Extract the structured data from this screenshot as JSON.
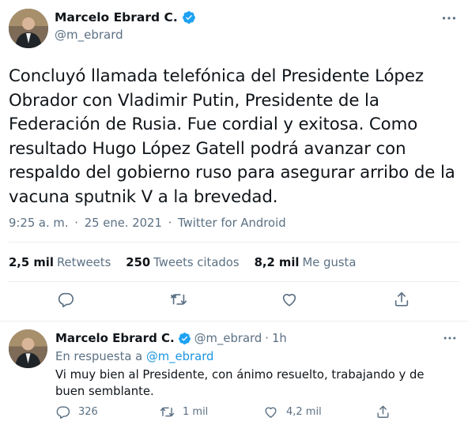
{
  "main_tweet": {
    "display_name": "Marcelo Ebrard C.",
    "handle": "@m_ebrard",
    "text_lines": [
      "Concluyó llamada telefónica del Presidente López",
      "Obrador con Vladimir Putin, Presidente de la",
      "Federación de Rusia. Fue cordial y exitosa. Como",
      "resultado Hugo López Gatell podrá avanzar con",
      "respaldo del gobierno ruso para asegurar arribo de la",
      "vacuna sputnik V a la brevedad."
    ],
    "time": "9:25 a. m.",
    "separator": "·",
    "date": "25 ene. 2021",
    "source": "Twitter for Android",
    "stats": {
      "retweets_count": "2,5 mil",
      "retweets_label": "Retweets",
      "quotes_count": "250",
      "quotes_label": "Tweets citados",
      "likes_count": "8,2 mil",
      "likes_label": "Me gusta"
    },
    "actions": [
      "reply-icon",
      "retweet-icon",
      "like-icon",
      "share-icon"
    ]
  },
  "reply_tweet": {
    "display_name": "Marcelo Ebrard C.",
    "handle": "@m_ebrard",
    "dot": "·",
    "time": "1h",
    "in_reply_prefix": "En respuesta a",
    "in_reply_handle": "@m_ebrard",
    "text": "Vi muy bien al Presidente, con ánimo resuelto, trabajando y de buen semblante.",
    "replies_count": "326",
    "retweets_count": "1 mil",
    "likes_count": "4,2 mil"
  },
  "colors": {
    "text": "#0f1419",
    "muted": "#5b7083",
    "accent": "#1b95e0",
    "verified": "#1da1f2",
    "divider": "#ebeef0"
  }
}
